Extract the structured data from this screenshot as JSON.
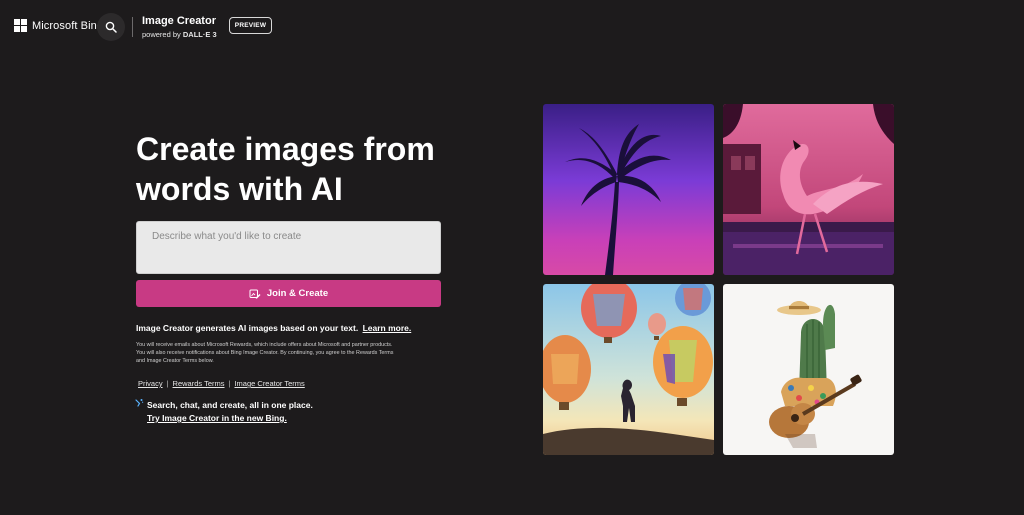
{
  "header": {
    "brand": "Microsoft Bing",
    "product_title": "Image Creator",
    "product_sub_prefix": "powered by",
    "product_sub_model": "DALL·E 3",
    "badge": "PREVIEW",
    "search_icon": "search-icon",
    "logo_icon": "microsoft-logo-icon"
  },
  "main": {
    "headline": "Create images from words with AI",
    "prompt_placeholder": "Describe what you'd like to create",
    "prompt_value": "",
    "join_button": "Join & Create",
    "join_icon": "image-edit-icon",
    "info_text": "Image Creator generates AI images based on your text.",
    "learn_more": "Learn more.",
    "fine_print": "You will receive emails about Microsoft Rewards, which include offers about Microsoft and partner products. You will also receive notifications about Bing Image Creator. By continuing, you agree to the Rewards Terms and Image Creator Terms below.",
    "links": [
      "Privacy",
      "Rewards Terms",
      "Image Creator Terms"
    ],
    "link_separator": "|",
    "promo_text": "Search, chat, and create, all in one place.",
    "promo_link": "Try Image Creator in the new Bing.",
    "promo_icon": "bing-chat-sparkle-icon"
  },
  "gallery": [
    {
      "name": "palm-tree-synthwave"
    },
    {
      "name": "pink-flamingo-street"
    },
    {
      "name": "hot-air-balloons-man"
    },
    {
      "name": "cactus-playing-guitar"
    }
  ],
  "colors": {
    "background": "#1d1b1c",
    "accent": "#c83a84",
    "input_bg": "#e9e9e9"
  }
}
